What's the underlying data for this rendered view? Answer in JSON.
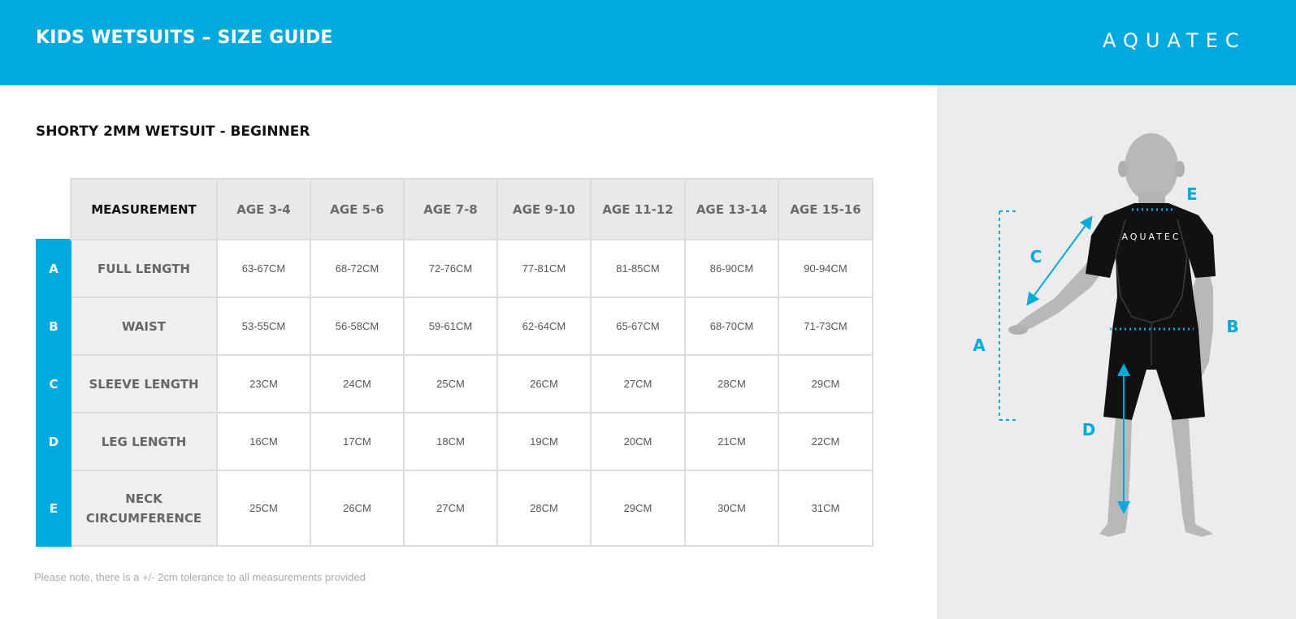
{
  "header": {
    "title": "KIDS WETSUITS – SIZE GUIDE",
    "brand": "AQUATEC"
  },
  "section": {
    "title": "SHORTY 2MM WETSUIT - BEGINNER"
  },
  "table": {
    "header_label": "MEASUREMENT",
    "columns": [
      "AGE 3-4",
      "AGE 5-6",
      "AGE 7-8",
      "AGE 9-10",
      "AGE 11-12",
      "AGE 13-14",
      "AGE 15-16"
    ],
    "rows": [
      {
        "letter": "A",
        "label": "FULL LENGTH",
        "values": [
          "63-67CM",
          "68-72CM",
          "72-76CM",
          "77-81CM",
          "81-85CM",
          "86-90CM",
          "90-94CM"
        ]
      },
      {
        "letter": "B",
        "label": "WAIST",
        "values": [
          "53-55CM",
          "56-58CM",
          "59-61CM",
          "62-64CM",
          "65-67CM",
          "68-70CM",
          "71-73CM"
        ]
      },
      {
        "letter": "C",
        "label": "SLEEVE LENGTH",
        "values": [
          "23CM",
          "24CM",
          "25CM",
          "26CM",
          "27CM",
          "28CM",
          "29CM"
        ]
      },
      {
        "letter": "D",
        "label": "LEG LENGTH",
        "values": [
          "16CM",
          "17CM",
          "18CM",
          "19CM",
          "20CM",
          "21CM",
          "22CM"
        ]
      },
      {
        "letter": "E",
        "label_line1": "NECK",
        "label_line2": "CIRCUMFERENCE",
        "values": [
          "25CM",
          "26CM",
          "27CM",
          "28CM",
          "29CM",
          "30CM",
          "31CM"
        ]
      }
    ]
  },
  "note": "Please note, there is a +/- 2cm tolerance to all measurements provided",
  "diagram": {
    "labels": {
      "a": "A",
      "b": "B",
      "c": "C",
      "d": "D",
      "e": "E"
    },
    "suit_logo": "AQUATEC"
  },
  "colors": {
    "accent": "#00a9de",
    "header_text": "#ffffff",
    "panel_bg": "#ececec",
    "table_header_bg": "#e9e9e9",
    "row_label_bg": "#efefef",
    "border": "#dcdcdc"
  }
}
